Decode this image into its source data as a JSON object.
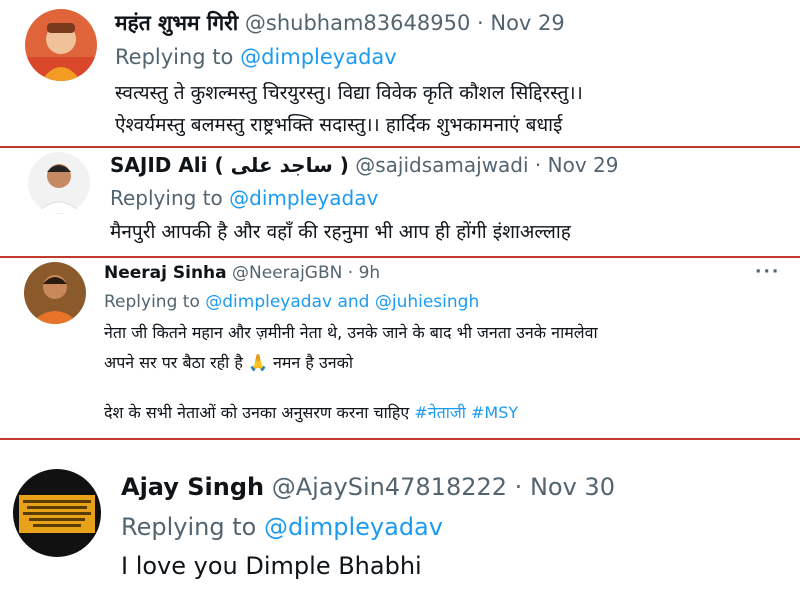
{
  "tweets": [
    {
      "name": "महंत शुभम गिरी",
      "handle": "@shubham83648950",
      "dot": "·",
      "time": "Nov 29",
      "reply_prefix": "Replying to",
      "mentions": [
        "@dimpleyadav"
      ],
      "body": [
        "स्वत्यस्तु ते कुशल्मस्तु चिरयुरस्तु। विद्या विवेक कृति कौशल सिद्दिरस्तु।।",
        "ऐश्वर्यमस्तु बलमस्तु राष्ट्रभक्ति सदास्तु।। हार्दिक शुभकामनाएं बधाई"
      ]
    },
    {
      "name": "SAJID Ali ( ساجد علی )",
      "handle": "@sajidsamajwadi",
      "dot": "·",
      "time": "Nov 29",
      "reply_prefix": "Replying to",
      "mentions": [
        "@dimpleyadav"
      ],
      "body": [
        "मैनपुरी आपकी है और वहाँ की रहनुमा भी आप ही होंगी इंशाअल्लाह"
      ]
    },
    {
      "name": "Neeraj Sinha",
      "handle": "@NeerajGBN",
      "dot": "·",
      "time": "9h",
      "more": "···",
      "reply_prefix": "Replying to",
      "mentions": [
        "@dimpleyadav",
        "@juhiesingh"
      ],
      "mention_join": "and",
      "body": [
        "नेता जी कितने महान और ज़मीनी नेता थे, उनके जाने के बाद भी जनता उनके नामलेवा",
        "अपने सर पर बैठा रही है 🙏 नमन है उनको",
        "देश के सभी नेताओं को उनका अनुसरण करना चाहिए"
      ],
      "hashtags": [
        "#नेताजी",
        "#MSY"
      ]
    },
    {
      "name": "Ajay Singh",
      "handle": "@AjaySin47818222",
      "dot": "·",
      "time": "Nov 30",
      "reply_prefix": "Replying to",
      "mentions": [
        "@dimpleyadav"
      ],
      "body": [
        "I love you Dimple Bhabhi"
      ]
    }
  ]
}
